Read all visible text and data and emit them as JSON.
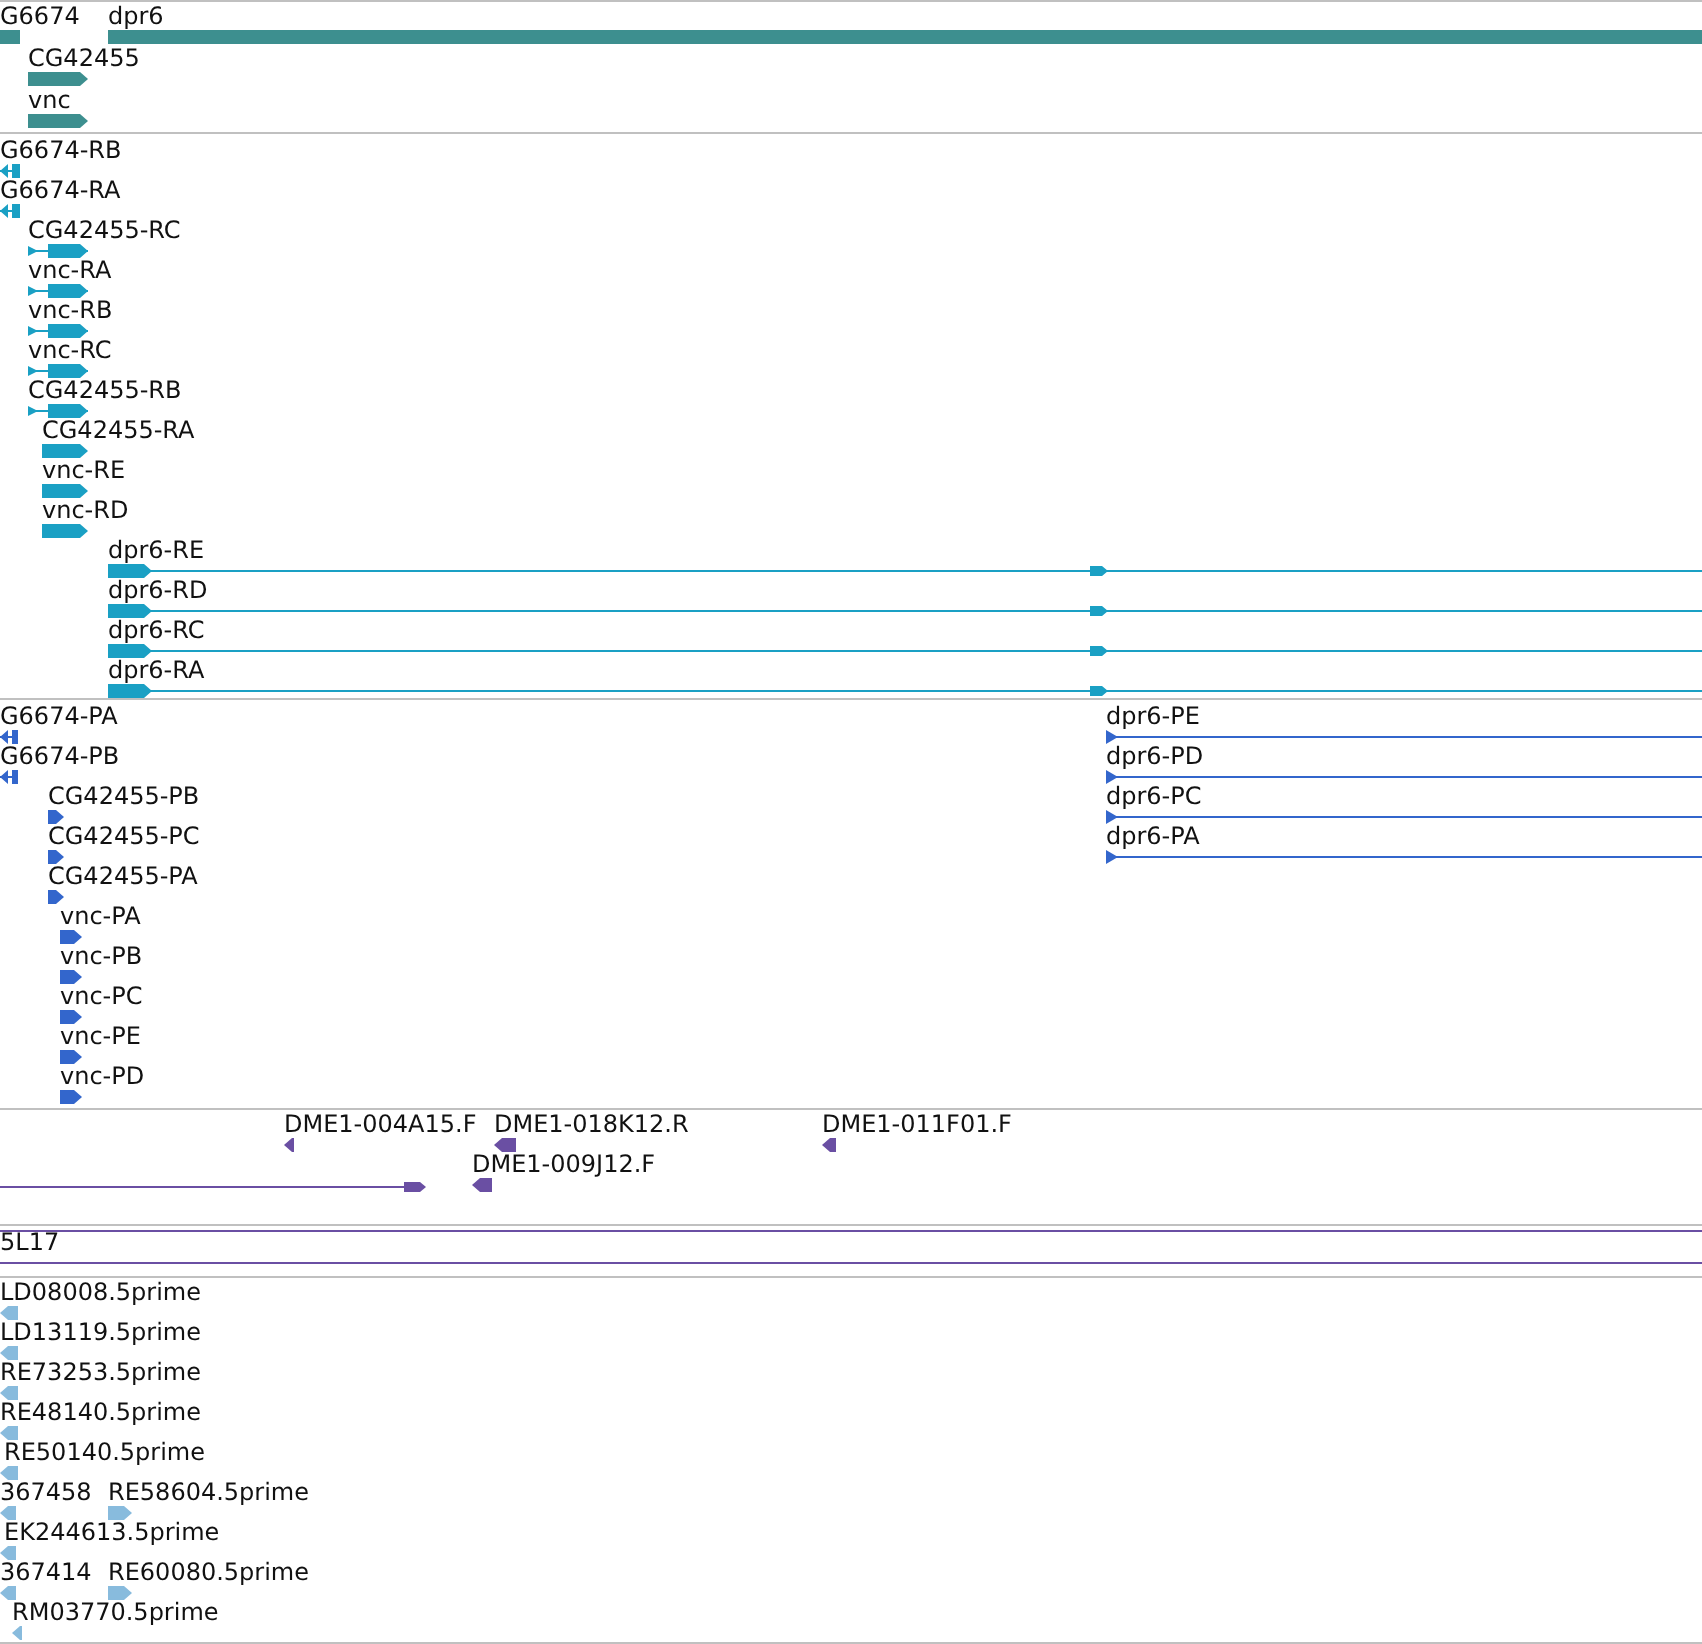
{
  "tracks": [
    {
      "kind": "gene",
      "features": [
        {
          "label": "G6674"
        },
        {
          "label": "dpr6"
        },
        {
          "label": "CG42455"
        },
        {
          "label": "vnc"
        }
      ]
    },
    {
      "kind": "transcript",
      "features": [
        {
          "label": "G6674-RB"
        },
        {
          "label": "G6674-RA"
        },
        {
          "label": "CG42455-RC"
        },
        {
          "label": "vnc-RA"
        },
        {
          "label": "vnc-RB"
        },
        {
          "label": "vnc-RC"
        },
        {
          "label": "CG42455-RB"
        },
        {
          "label": "CG42455-RA"
        },
        {
          "label": "vnc-RE"
        },
        {
          "label": "vnc-RD"
        },
        {
          "label": "dpr6-RE"
        },
        {
          "label": "dpr6-RD"
        },
        {
          "label": "dpr6-RC"
        },
        {
          "label": "dpr6-RA"
        }
      ]
    },
    {
      "kind": "protein",
      "features": [
        {
          "label": "G6674-PA"
        },
        {
          "label": "dpr6-PE"
        },
        {
          "label": "G6674-PB"
        },
        {
          "label": "dpr6-PD"
        },
        {
          "label": "CG42455-PB"
        },
        {
          "label": "dpr6-PC"
        },
        {
          "label": "CG42455-PC"
        },
        {
          "label": "dpr6-PA"
        },
        {
          "label": "CG42455-PA"
        },
        {
          "label": "vnc-PA"
        },
        {
          "label": "vnc-PB"
        },
        {
          "label": "vnc-PC"
        },
        {
          "label": "vnc-PE"
        },
        {
          "label": "vnc-PD"
        }
      ]
    },
    {
      "kind": "clone",
      "features": [
        {
          "label": "DME1-004A15.F"
        },
        {
          "label": "DME1-018K12.R"
        },
        {
          "label": "DME1-011F01.F"
        },
        {
          "label": "DME1-009J12.F"
        }
      ]
    },
    {
      "kind": "scaffold",
      "features": [
        {
          "label": "5L17"
        }
      ]
    },
    {
      "kind": "est",
      "features": [
        {
          "label": "LD08008.5prime"
        },
        {
          "label": "LD13119.5prime"
        },
        {
          "label": "RE73253.5prime"
        },
        {
          "label": "RE48140.5prime"
        },
        {
          "label": "RE50140.5prime"
        },
        {
          "label": "367458"
        },
        {
          "label": "RE58604.5prime"
        },
        {
          "label": "EK244613.5prime"
        },
        {
          "label": "367414"
        },
        {
          "label": "RE60080.5prime"
        },
        {
          "label": "RM03770.5prime"
        }
      ]
    }
  ]
}
